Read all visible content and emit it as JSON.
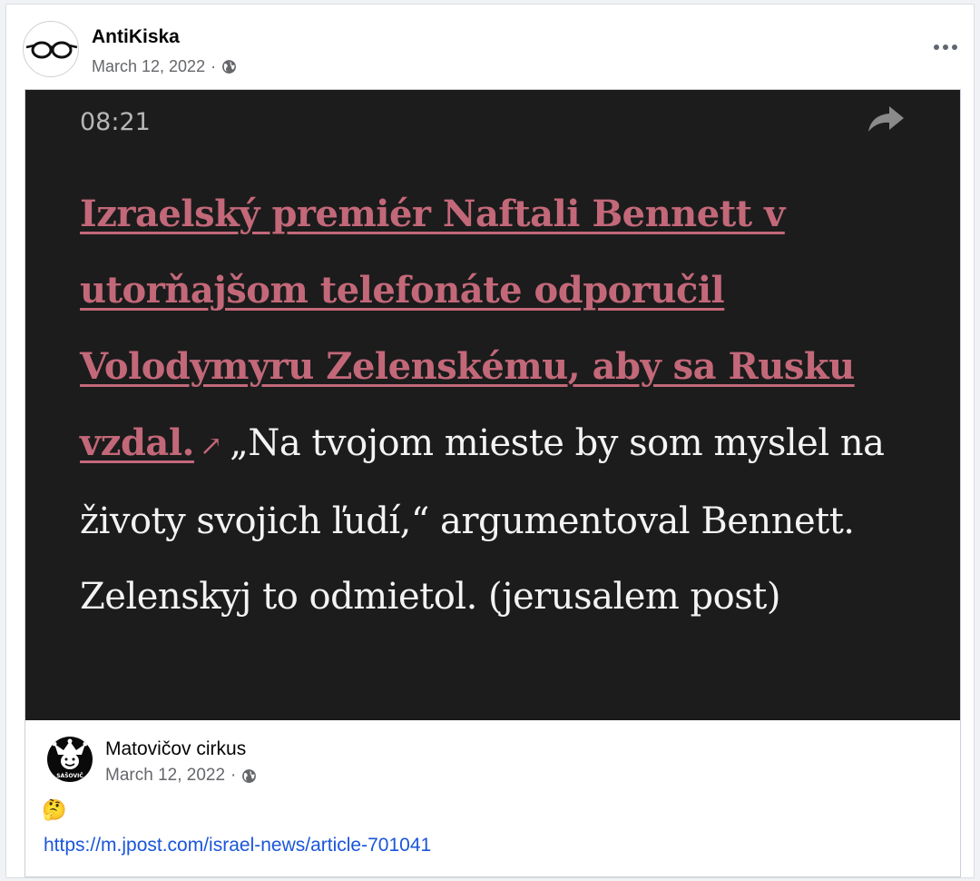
{
  "post": {
    "author": "AntiKiska",
    "date": "March 12, 2022",
    "separator": "·",
    "avatar_icon": "glasses-icon",
    "privacy_icon": "globe-icon"
  },
  "image": {
    "time": "08:21",
    "headline_link": "Izraelský premiér Naftali Bennett v utorňajšom telefonáte odporučil Volodymyru Zelenskému, aby sa Rusku vzdal.",
    "link_arrow": "↗",
    "quote": "„Na tvojom mieste by som myslel na životy svojich ľudí,“ argumentoval Bennett. Zelenskyj to odmietol. (jerusalem post)",
    "colors": {
      "background": "#1c1c1c",
      "link": "#c36879",
      "text": "#f3f3f3"
    }
  },
  "shared": {
    "author": "Matovičov cirkus",
    "date": "March 12, 2022",
    "separator": "·",
    "emoji": "🤔",
    "link": "https://m.jpost.com/israel-news/article-701041",
    "avatar_icon": "jester-icon",
    "avatar_text": "SAŠOVIČ"
  }
}
